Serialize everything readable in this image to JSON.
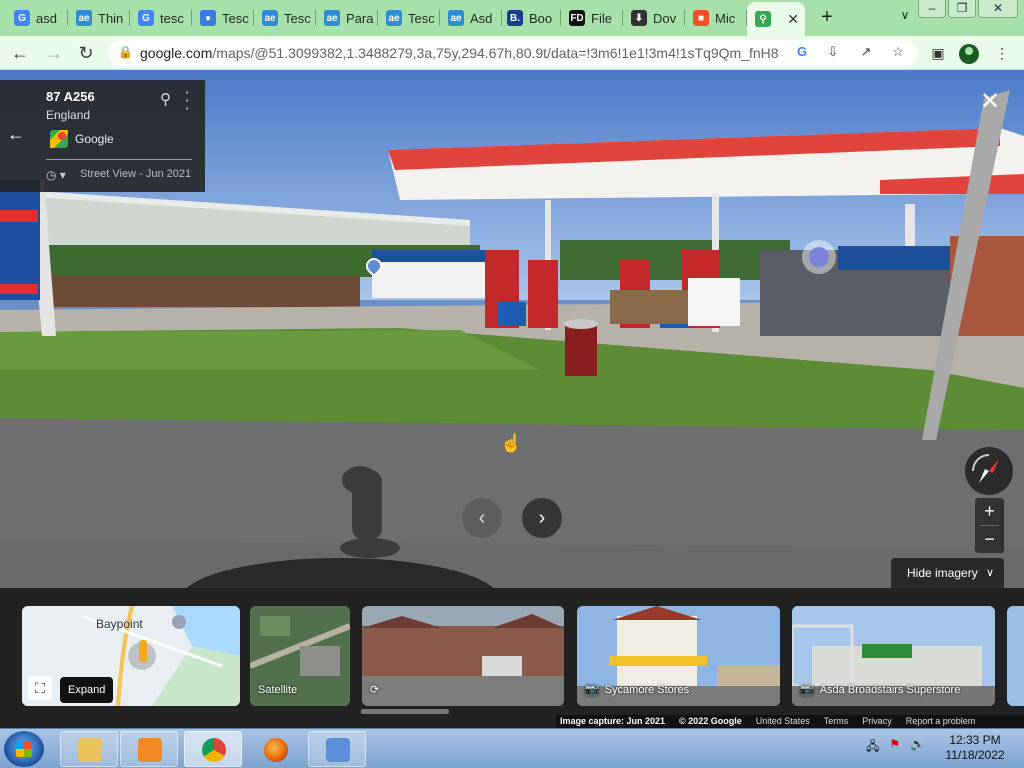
{
  "browser": {
    "tabs": [
      {
        "label": "asd",
        "favicon": "google-icon",
        "color": "#4285f4"
      },
      {
        "label": "Thin",
        "favicon": "ae-icon",
        "color": "#2d8fd1"
      },
      {
        "label": "tesc",
        "favicon": "google-icon",
        "color": "#4285f4"
      },
      {
        "label": "Tesc",
        "favicon": "chrome-blue-icon",
        "color": "#3b7be0"
      },
      {
        "label": "Tesc",
        "favicon": "ae-icon",
        "color": "#2d8fd1"
      },
      {
        "label": "Para",
        "favicon": "ae-icon",
        "color": "#2d8fd1"
      },
      {
        "label": "Tesc",
        "favicon": "ae-icon",
        "color": "#2d8fd1"
      },
      {
        "label": "Asd",
        "favicon": "ae-icon",
        "color": "#2d8fd1"
      },
      {
        "label": "Boo",
        "favicon": "booking-icon",
        "color": "#1a3d8f"
      },
      {
        "label": "File",
        "favicon": "fd-icon",
        "color": "#111111"
      },
      {
        "label": "Dov",
        "favicon": "download-icon",
        "color": "#333333"
      },
      {
        "label": "Mic",
        "favicon": "microsoft-icon",
        "color": "#f25022"
      },
      {
        "label": "",
        "favicon": "maps-icon",
        "color": "#34a853"
      }
    ],
    "url_host": "google.com",
    "url_path": "/maps/@51.3099382,1.3488279,3a,75y,294.67h,80.9t/data=!3m6!1e1!3m4!1sTq9Qm_fnH8..."
  },
  "streetview": {
    "address": "87 A256",
    "region": "England",
    "provider": "Google",
    "capture_label": "Street View - Jun 2021",
    "hide_imagery_label": "Hide imagery"
  },
  "filmstrip": {
    "map_place_label": "Baypoint",
    "expand_label": "Expand",
    "cards": [
      {
        "label": "Satellite",
        "icon": ""
      },
      {
        "label": "",
        "icon": "360-icon"
      },
      {
        "label": "Sycamore Stores",
        "icon": "camera-icon"
      },
      {
        "label": "Asda Broadstairs Superstore",
        "icon": "camera-icon"
      }
    ]
  },
  "footer": {
    "capture": "Image capture: Jun 2021",
    "copyright": "© 2022 Google",
    "country": "United States",
    "terms": "Terms",
    "privacy": "Privacy",
    "report": "Report a problem"
  },
  "taskbar": {
    "time": "12:33 PM",
    "date": "11/18/2022"
  }
}
